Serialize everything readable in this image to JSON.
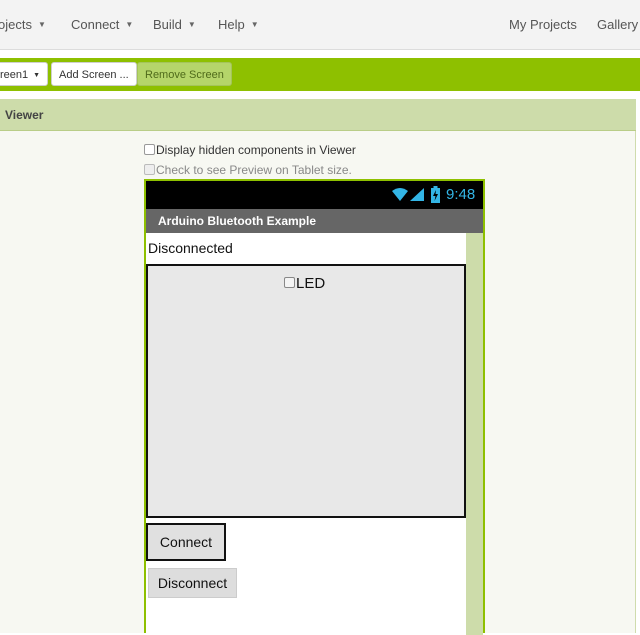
{
  "menu": {
    "projects": "ojects",
    "connect": "Connect",
    "build": "Build",
    "help": "Help",
    "my_projects": "My Projects",
    "gallery": "Gallery"
  },
  "toolbar": {
    "screen_select": "reen1",
    "add_screen": "Add Screen ...",
    "remove_screen": "Remove Screen"
  },
  "viewer": {
    "title": "Viewer",
    "display_hidden_label": "Display hidden components in Viewer",
    "tablet_preview_label": "Check to see Preview on Tablet size."
  },
  "phone": {
    "time": "9:48",
    "app_title": "Arduino Bluetooth Example",
    "status_label": "Disconnected",
    "led_checkbox_label": "LED",
    "connect_button": "Connect",
    "disconnect_button": "Disconnect"
  },
  "colors": {
    "accent_green": "#8ec000",
    "panel_green": "#cddcaa",
    "clock_blue": "#33b5e5"
  }
}
